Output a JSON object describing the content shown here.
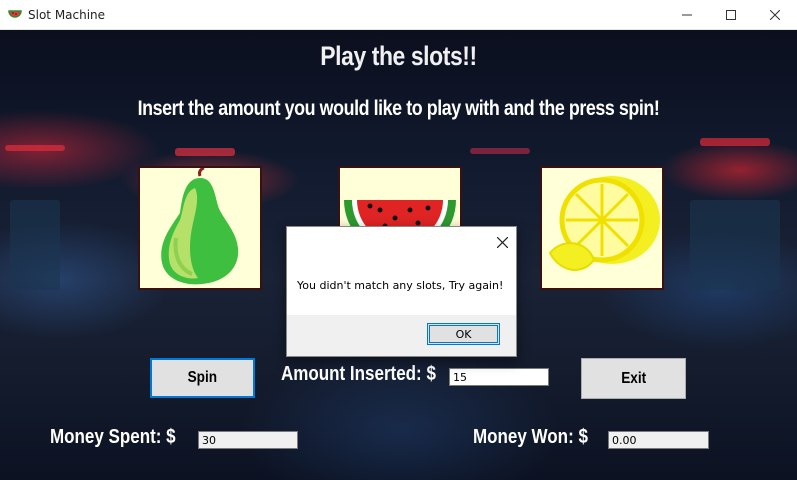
{
  "window": {
    "title": "Slot Machine",
    "app_icon": "watermelon-icon",
    "controls": [
      "minimize-icon",
      "maximize-icon",
      "close-icon"
    ]
  },
  "main": {
    "title": "Play the slots!!",
    "instructions": "Insert the amount you would like to play with and the press spin!",
    "slots": [
      {
        "fruit": "pear",
        "icon": "pear-icon"
      },
      {
        "fruit": "watermelon",
        "icon": "watermelon-icon"
      },
      {
        "fruit": "lemon",
        "icon": "lemon-icon"
      }
    ],
    "spin_button": "Spin",
    "exit_button": "Exit",
    "amount_label": "Amount Inserted:  $",
    "amount_value": "15",
    "money_spent_label": "Money Spent:  $",
    "money_spent_value": "30",
    "money_won_label": "Money Won:  $",
    "money_won_value": "0.00"
  },
  "dialog": {
    "message": "You didn't match any slots, Try again!",
    "ok_button": "OK"
  },
  "colors": {
    "slot_background": "#ffffd8",
    "focus_border": "#0078d7",
    "button_face": "#e1e1e1"
  }
}
